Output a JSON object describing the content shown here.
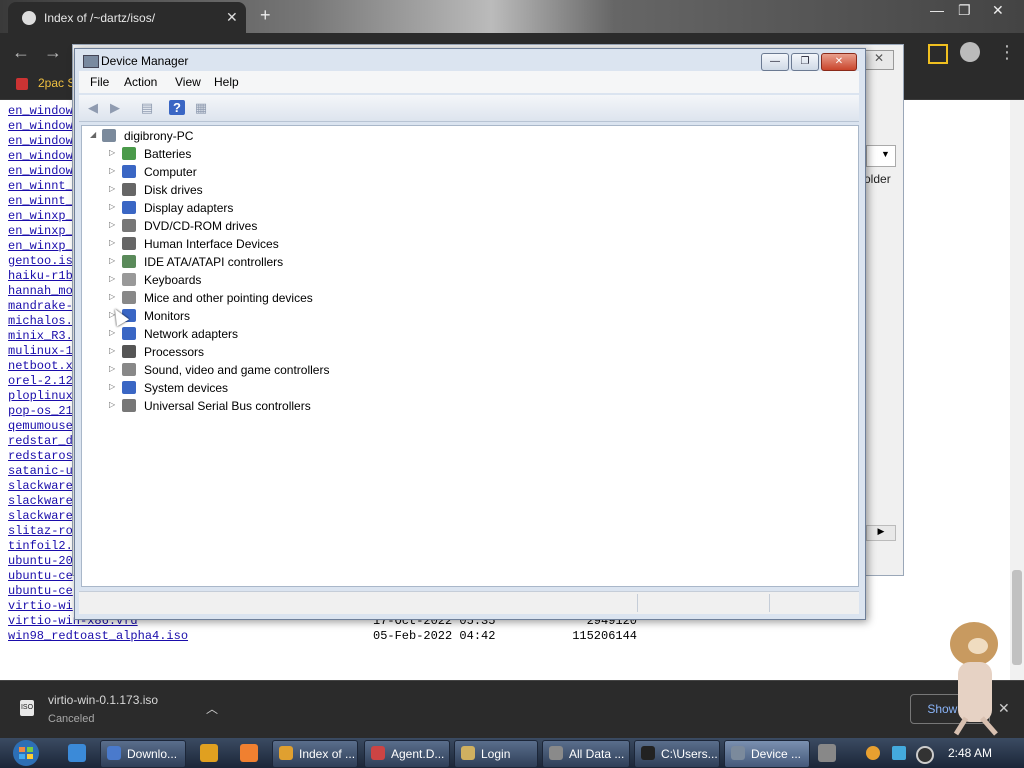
{
  "browser": {
    "tab_title": "Index of /~dartz/isos/",
    "new_tab": "+",
    "bookmark": "2pac S",
    "controls": {
      "minimize": "—",
      "restore": "❐",
      "close": "✕"
    }
  },
  "page": {
    "files": [
      {
        "name": "en_window",
        "date": "",
        "size": ""
      },
      {
        "name": "en_window",
        "date": "",
        "size": ""
      },
      {
        "name": "en_window",
        "date": "",
        "size": ""
      },
      {
        "name": "en_window",
        "date": "",
        "size": ""
      },
      {
        "name": "en_window",
        "date": "",
        "size": ""
      },
      {
        "name": "en_winnt_",
        "date": "",
        "size": ""
      },
      {
        "name": "en_winnt_",
        "date": "",
        "size": ""
      },
      {
        "name": "en_winxp_",
        "date": "",
        "size": ""
      },
      {
        "name": "en_winxp_",
        "date": "",
        "size": ""
      },
      {
        "name": "en_winxp_",
        "date": "",
        "size": ""
      },
      {
        "name": "gentoo.is",
        "date": "",
        "size": ""
      },
      {
        "name": "haiku-r1b",
        "date": "",
        "size": ""
      },
      {
        "name": "hannah_mo",
        "date": "",
        "size": ""
      },
      {
        "name": "mandrake-",
        "date": "",
        "size": ""
      },
      {
        "name": "michalos.",
        "date": "",
        "size": ""
      },
      {
        "name": "minix_R3.",
        "date": "",
        "size": ""
      },
      {
        "name": "mulinux-1",
        "date": "",
        "size": ""
      },
      {
        "name": "netboot.x",
        "date": "",
        "size": ""
      },
      {
        "name": "orel-2.12",
        "date": "",
        "size": ""
      },
      {
        "name": "ploplinux",
        "date": "",
        "size": ""
      },
      {
        "name": "pop-os_21",
        "date": "",
        "size": ""
      },
      {
        "name": "qemumouse",
        "date": "",
        "size": ""
      },
      {
        "name": "redstar_d",
        "date": "",
        "size": ""
      },
      {
        "name": "redstaros",
        "date": "",
        "size": ""
      },
      {
        "name": "satanic-u",
        "date": "",
        "size": ""
      },
      {
        "name": "slackware",
        "date": "",
        "size": ""
      },
      {
        "name": "slackware",
        "date": "",
        "size": ""
      },
      {
        "name": "slackware",
        "date": "",
        "size": ""
      },
      {
        "name": "slitaz-ro",
        "date": "",
        "size": ""
      },
      {
        "name": "tinfoil2.",
        "date": "",
        "size": ""
      },
      {
        "name": "ubuntu-20",
        "date": "",
        "size": ""
      },
      {
        "name": "ubuntu-ce",
        "date": "",
        "size": ""
      },
      {
        "name": "ubuntu-ce",
        "date": "",
        "size": ""
      },
      {
        "name": "virtio-wi",
        "date": "",
        "size": ""
      },
      {
        "name": "virtio-win-x86.vfd",
        "date": "17-Oct-2022 05:35",
        "size": "2949120"
      },
      {
        "name": "win98_redtoast_alpha4.iso",
        "date": "05-Feb-2022 04:42",
        "size": "115206144"
      }
    ]
  },
  "background_dialog": {
    "folder_label": "older",
    "close": "✕"
  },
  "device_manager": {
    "title": "Device Manager",
    "menu": [
      "File",
      "Action",
      "View",
      "Help"
    ],
    "buttons": {
      "minimize": "—",
      "restore": "❐",
      "close": "✕"
    },
    "toolbar": {
      "back": "◀",
      "forward": "▶",
      "properties": "▤",
      "help": "?",
      "scan": "▦"
    },
    "root": "digibrony-PC",
    "categories": [
      {
        "label": "Batteries",
        "icon": "battery-icon",
        "color": "#4a9a4a"
      },
      {
        "label": "Computer",
        "icon": "computer-icon",
        "color": "#3a66c4"
      },
      {
        "label": "Disk drives",
        "icon": "disk-drive-icon",
        "color": "#666666"
      },
      {
        "label": "Display adapters",
        "icon": "display-adapter-icon",
        "color": "#3a66c4"
      },
      {
        "label": "DVD/CD-ROM drives",
        "icon": "dvd-drive-icon",
        "color": "#777777"
      },
      {
        "label": "Human Interface Devices",
        "icon": "hid-icon",
        "color": "#666666"
      },
      {
        "label": "IDE ATA/ATAPI controllers",
        "icon": "ide-controller-icon",
        "color": "#5a8a5a"
      },
      {
        "label": "Keyboards",
        "icon": "keyboard-icon",
        "color": "#999999"
      },
      {
        "label": "Mice and other pointing devices",
        "icon": "mouse-icon",
        "color": "#888888"
      },
      {
        "label": "Monitors",
        "icon": "monitor-icon",
        "color": "#3a66c4"
      },
      {
        "label": "Network adapters",
        "icon": "network-adapter-icon",
        "color": "#3a66c4"
      },
      {
        "label": "Processors",
        "icon": "processor-icon",
        "color": "#555555"
      },
      {
        "label": "Sound, video and game controllers",
        "icon": "sound-icon",
        "color": "#888888"
      },
      {
        "label": "System devices",
        "icon": "system-devices-icon",
        "color": "#3a66c4"
      },
      {
        "label": "Universal Serial Bus controllers",
        "icon": "usb-icon",
        "color": "#777777"
      }
    ]
  },
  "download": {
    "file": "virtio-win-0.1.173.iso",
    "status": "Canceled",
    "icon_text": "ISO",
    "show_all": "Show all",
    "close": "✕",
    "chevron": "︿"
  },
  "taskbar": {
    "tasks": [
      {
        "label": "Downlo...",
        "color": "#4a7acc"
      },
      {
        "label": "Index of ...",
        "color": "#e0a030"
      },
      {
        "label": "Agent.D...",
        "color": "#cc4444"
      },
      {
        "label": "Login",
        "color": "#d0b060"
      },
      {
        "label": "All Data ...",
        "color": "#8a8a8a"
      },
      {
        "label": "C:\\Users...",
        "color": "#222222"
      },
      {
        "label": "Device ...",
        "color": "#7b8a9c"
      }
    ],
    "clock": "2:48 AM"
  }
}
